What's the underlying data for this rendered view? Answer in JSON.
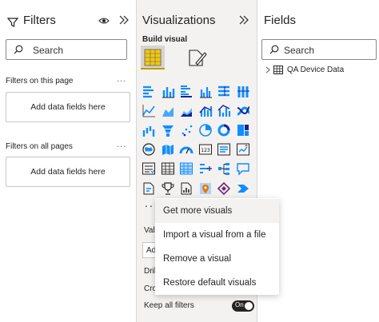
{
  "filters": {
    "title": "Filters",
    "search_placeholder": "Search",
    "on_this_page_label": "Filters on this page",
    "on_this_page_drop": "Add data fields here",
    "on_all_pages_label": "Filters on all pages",
    "on_all_pages_drop": "Add data fields here",
    "more": "..."
  },
  "visualizations": {
    "title": "Visualizations",
    "build_visual_label": "Build visual",
    "more_visuals": "...",
    "values_peek": "Valu",
    "add_peek": "Add",
    "drill_peek": "Dril",
    "cross_peek": "Cro",
    "keep_all_filters_label": "Keep all filters",
    "keep_all_filters_toggle": "On",
    "icons": [
      "stacked-bar-chart-icon",
      "stacked-column-chart-icon",
      "clustered-bar-chart-icon",
      "clustered-column-chart-icon",
      "100-stacked-bar-chart-icon",
      "100-stacked-column-chart-icon",
      "line-chart-icon",
      "area-chart-icon",
      "stacked-area-chart-icon",
      "line-and-stacked-column-icon",
      "line-and-clustered-column-icon",
      "ribbon-chart-icon",
      "waterfall-chart-icon",
      "funnel-chart-icon",
      "scatter-chart-icon",
      "pie-chart-icon",
      "donut-chart-icon",
      "treemap-icon",
      "map-icon",
      "filled-map-icon",
      "gauge-icon",
      "card-icon",
      "multi-row-card-icon",
      "kpi-icon",
      "slicer-icon",
      "table-icon",
      "matrix-icon",
      "key-influencers-icon",
      "decomposition-tree-icon",
      "qa-icon",
      "smart-narrative-icon",
      "metrics-icon",
      "paginated-report-icon",
      "azure-map-icon",
      "power-apps-icon",
      "power-automate-icon"
    ]
  },
  "fields": {
    "title": "Fields",
    "search_placeholder": "Search",
    "tables": [
      {
        "name": "QA Device Data"
      }
    ]
  },
  "context_menu": {
    "items": [
      {
        "label": "Get more visuals"
      },
      {
        "label": "Import a visual from a file"
      },
      {
        "label": "Remove a visual"
      },
      {
        "label": "Restore default visuals"
      }
    ]
  },
  "colors": {
    "accent_yellow": "#b8a000",
    "chart_blue": "#118dff",
    "chart_dark": "#12239e",
    "toggle_dark": "#252423"
  }
}
